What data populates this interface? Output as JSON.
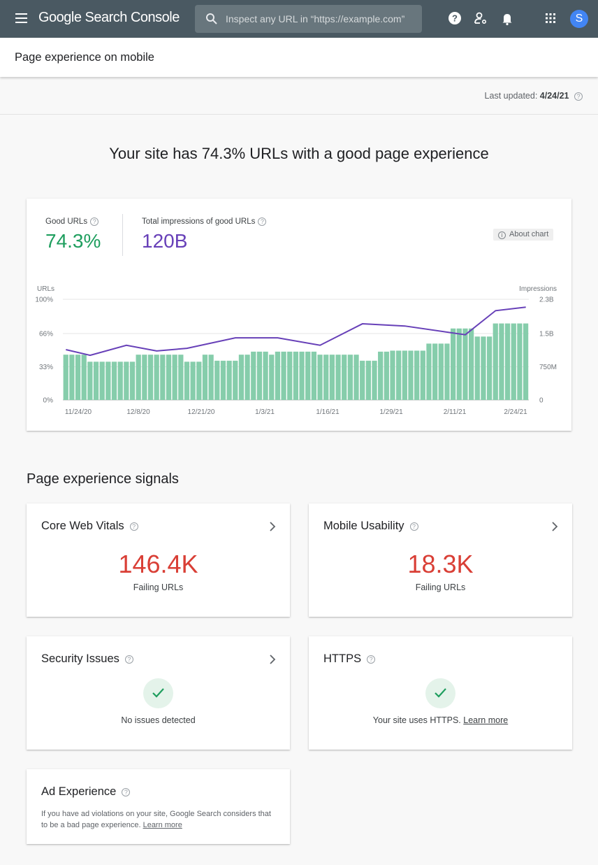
{
  "topbar": {
    "brand": "Google Search Console",
    "search_placeholder": "Inspect any URL in “https://example.com”",
    "icons": [
      "menu-icon",
      "search-icon",
      "help-icon",
      "manage-users-icon",
      "notifications-icon",
      "apps-grid-icon"
    ],
    "avatar_initial": "S"
  },
  "page": {
    "title": "Page experience on mobile",
    "last_updated_label": "Last updated:",
    "last_updated_value": "4/24/21"
  },
  "headline": "Your site has 74.3% URLs with a good page experience",
  "summary": {
    "good_urls_label": "Good URLs",
    "good_urls_value": "74.3%",
    "impressions_label": "Total impressions of good URLs",
    "impressions_value": "120B",
    "about_chart": "About chart"
  },
  "colors": {
    "good": "#1e9e5e",
    "impressions": "#6740b8",
    "bar": "#86cdab",
    "failing": "#d93f36",
    "topbar": "#4a5962"
  },
  "chart_data": {
    "type": "bar",
    "title": "",
    "ylabel": "URLs",
    "y2label": "Impressions",
    "ylim": [
      0,
      100
    ],
    "y2lim": [
      0,
      2.3
    ],
    "yticks": [
      "0%",
      "33%",
      "66%",
      "100%"
    ],
    "y2ticks": [
      "0",
      "750M",
      "1.5B",
      "2.3B"
    ],
    "xticks": [
      "11/24/20",
      "12/8/20",
      "12/21/20",
      "1/3/21",
      "1/16/21",
      "1/29/21",
      "2/11/21",
      "2/24/21"
    ],
    "grid": true,
    "legend": "none",
    "series": [
      {
        "name": "Good URLs (%)",
        "type": "bar",
        "values": [
          45,
          45,
          45,
          45,
          38,
          38,
          38,
          38,
          38,
          38,
          38,
          38,
          45,
          45,
          45,
          45,
          45,
          45,
          45,
          45,
          38,
          38,
          38,
          45,
          45,
          39,
          39,
          39,
          39,
          45,
          45,
          48,
          48,
          48,
          45,
          48,
          48,
          48,
          48,
          48,
          48,
          48,
          45,
          45,
          45,
          45,
          45,
          45,
          45,
          39,
          39,
          39,
          48,
          48,
          49,
          49,
          49,
          49,
          49,
          49,
          56,
          56,
          56,
          56,
          71,
          71,
          71,
          71,
          63,
          63,
          63,
          76,
          76,
          76,
          76,
          76,
          76
        ]
      },
      {
        "name": "Impressions (B)",
        "type": "line",
        "points": [
          {
            "bar": 0,
            "value": 1.15
          },
          {
            "bar": 4,
            "value": 1.02
          },
          {
            "bar": 10,
            "value": 1.25
          },
          {
            "bar": 15,
            "value": 1.12
          },
          {
            "bar": 20,
            "value": 1.18
          },
          {
            "bar": 28,
            "value": 1.42
          },
          {
            "bar": 35,
            "value": 1.42
          },
          {
            "bar": 42,
            "value": 1.25
          },
          {
            "bar": 49,
            "value": 1.74
          },
          {
            "bar": 56,
            "value": 1.69
          },
          {
            "bar": 66,
            "value": 1.49
          },
          {
            "bar": 71,
            "value": 2.04
          },
          {
            "bar": 76,
            "value": 2.12
          }
        ]
      }
    ]
  },
  "signals": {
    "section_title": "Page experience signals",
    "core_web_vitals": {
      "title": "Core Web Vitals",
      "value": "146.4K",
      "sub": "Failing URLs"
    },
    "mobile_usability": {
      "title": "Mobile Usability",
      "value": "18.3K",
      "sub": "Failing URLs"
    },
    "security_issues": {
      "title": "Security Issues",
      "status": "No issues detected"
    },
    "https": {
      "title": "HTTPS",
      "status": "Your site uses HTTPS.",
      "link": "Learn more"
    },
    "ad_experience": {
      "title": "Ad Experience",
      "desc": "If you have ad violations on your site, Google Search considers that to be a bad page experience.",
      "link": "Learn more"
    }
  }
}
